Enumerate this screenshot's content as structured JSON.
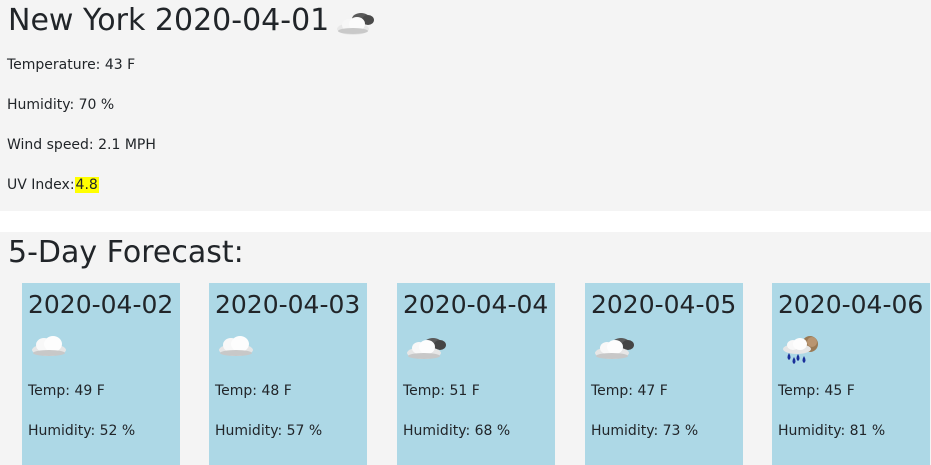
{
  "current": {
    "city_date": "New York 2020-04-01",
    "icon": "cloudy-icon",
    "temperature_label": "Temperature:",
    "temperature_value": "43 F",
    "humidity_label": "Humidity:",
    "humidity_value": "70 %",
    "wind_label": "Wind speed:",
    "wind_value": "2.1 MPH",
    "uv_label": "UV Index:",
    "uv_value": "4.8",
    "uv_highlight_color": "#ffff00"
  },
  "forecast": {
    "title": "5-Day Forecast:",
    "card_color": "#add8e6",
    "days": [
      {
        "date": "2020-04-02",
        "icon": "cloud-icon",
        "temp": "Temp: 49 F",
        "humidity": "Humidity: 52 %"
      },
      {
        "date": "2020-04-03",
        "icon": "cloud-icon",
        "temp": "Temp: 48 F",
        "humidity": "Humidity: 57 %"
      },
      {
        "date": "2020-04-04",
        "icon": "cloudy-icon",
        "temp": "Temp: 51 F",
        "humidity": "Humidity: 68 %"
      },
      {
        "date": "2020-04-05",
        "icon": "cloudy-icon",
        "temp": "Temp: 47 F",
        "humidity": "Humidity: 73 %"
      },
      {
        "date": "2020-04-06",
        "icon": "rain-icon",
        "temp": "Temp: 45 F",
        "humidity": "Humidity: 81 %"
      }
    ]
  }
}
